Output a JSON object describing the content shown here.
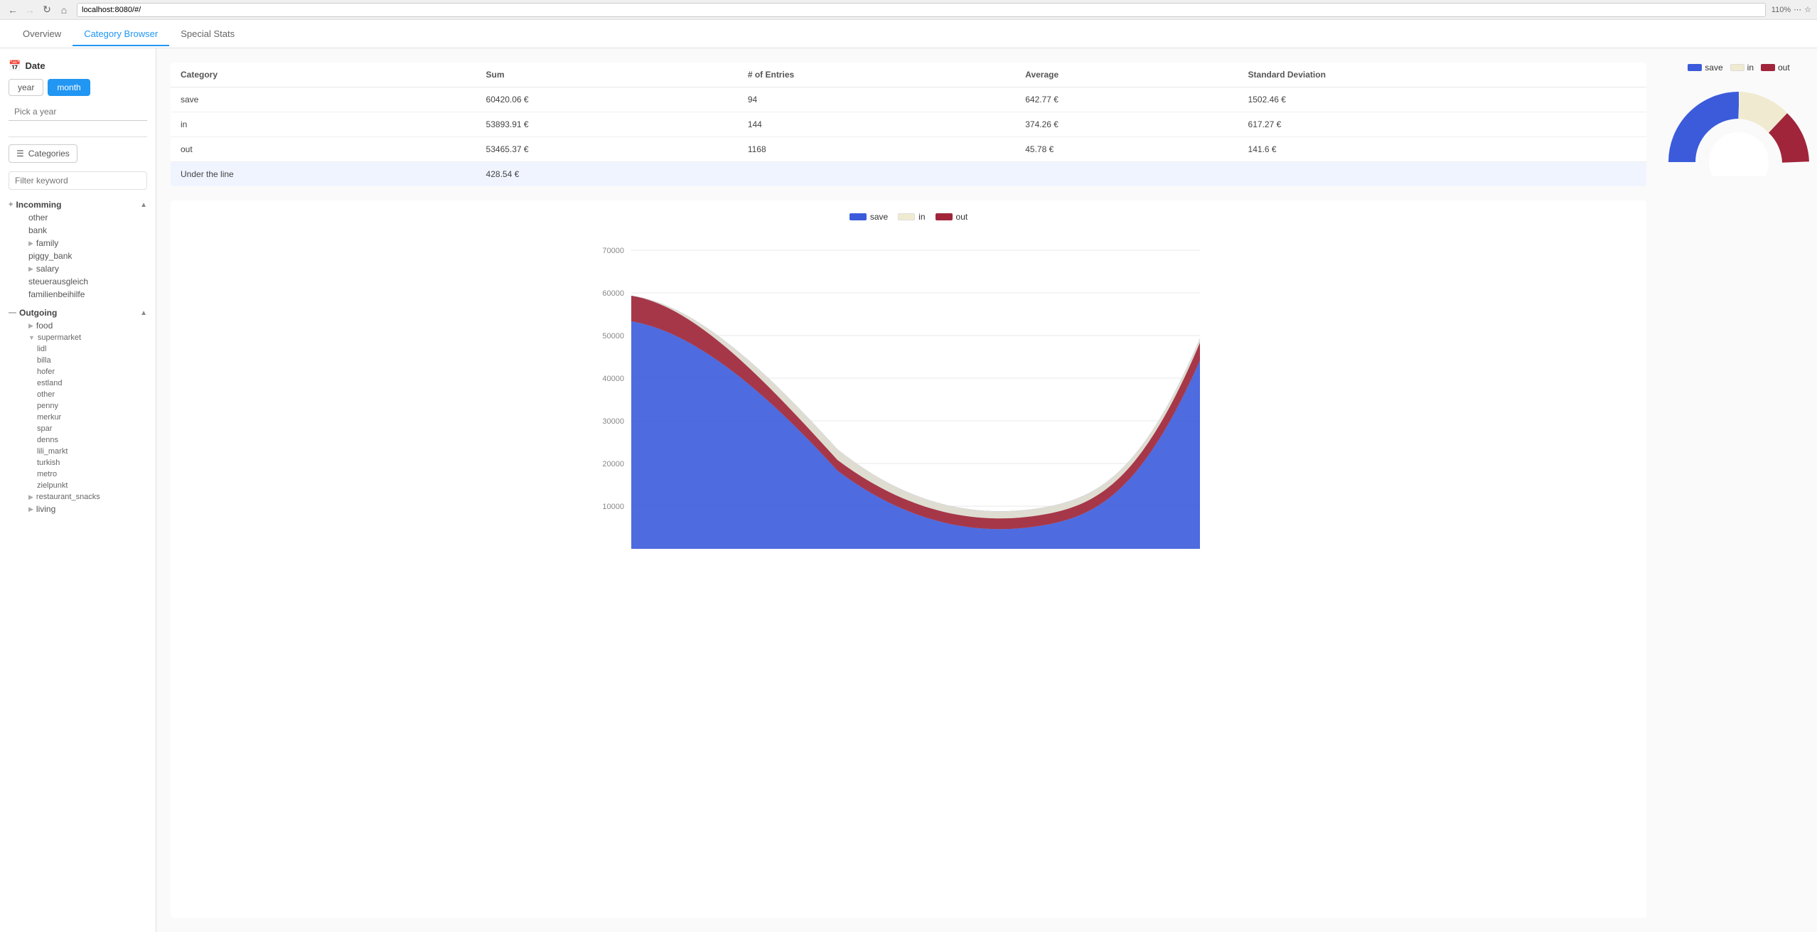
{
  "browser": {
    "url": "localhost:8080/#/",
    "zoom": "110%"
  },
  "tabs": [
    {
      "id": "overview",
      "label": "Overview",
      "active": false
    },
    {
      "id": "category-browser",
      "label": "Category Browser",
      "active": true
    },
    {
      "id": "special-stats",
      "label": "Special Stats",
      "active": false
    }
  ],
  "sidebar": {
    "date_label": "Date",
    "year_btn": "year",
    "month_btn": "month",
    "year_placeholder": "Pick a year",
    "categories_label": "Categories",
    "filter_placeholder": "Filter keyword",
    "incomming_label": "Incomming",
    "incomming_items": [
      {
        "label": "other",
        "level": 1
      },
      {
        "label": "bank",
        "level": 1
      },
      {
        "label": "family",
        "level": 1,
        "has_children": true
      },
      {
        "label": "piggy_bank",
        "level": 1
      },
      {
        "label": "salary",
        "level": 1,
        "has_children": true
      },
      {
        "label": "steuerausgleich",
        "level": 1
      },
      {
        "label": "familienbeihilfe",
        "level": 1
      }
    ],
    "outgoing_label": "Outgoing",
    "outgoing_items": [
      {
        "label": "food",
        "level": 1,
        "has_children": true,
        "children": [
          {
            "label": "supermarket",
            "level": 2,
            "has_children": true,
            "children": [
              {
                "label": "lidl",
                "level": 3
              },
              {
                "label": "billa",
                "level": 3
              },
              {
                "label": "hofer",
                "level": 3
              },
              {
                "label": "estland",
                "level": 3
              },
              {
                "label": "other",
                "level": 3
              },
              {
                "label": "penny",
                "level": 3
              },
              {
                "label": "merkur",
                "level": 3
              },
              {
                "label": "spar",
                "level": 3
              },
              {
                "label": "denns",
                "level": 3
              },
              {
                "label": "lili_markt",
                "level": 3
              },
              {
                "label": "turkish",
                "level": 3
              },
              {
                "label": "metro",
                "level": 3
              },
              {
                "label": "zielpunkt",
                "level": 3
              }
            ]
          },
          {
            "label": "restaurant_snacks",
            "level": 2,
            "has_children": true
          }
        ]
      },
      {
        "label": "living",
        "level": 1,
        "has_children": true
      }
    ]
  },
  "table": {
    "headers": [
      "Category",
      "Sum",
      "# of Entries",
      "Average",
      "Standard Deviation"
    ],
    "rows": [
      {
        "category": "save",
        "sum": "60420.06 €",
        "entries": "94",
        "average": "642.77 €",
        "std_dev": "1502.46 €",
        "highlight": false
      },
      {
        "category": "in",
        "sum": "53893.91 €",
        "entries": "144",
        "average": "374.26 €",
        "std_dev": "617.27 €",
        "highlight": false
      },
      {
        "category": "out",
        "sum": "53465.37 €",
        "entries": "1168",
        "average": "45.78 €",
        "std_dev": "141.6 €",
        "highlight": false
      },
      {
        "category": "Under the line",
        "sum": "428.54 €",
        "entries": "",
        "average": "",
        "std_dev": "",
        "highlight": true
      }
    ]
  },
  "chart": {
    "legend": [
      {
        "label": "save",
        "color": "#3b5bdb"
      },
      {
        "label": "in",
        "color": "#f5f0d0"
      },
      {
        "label": "out",
        "color": "#a0253a"
      }
    ],
    "y_labels": [
      "70000",
      "60000",
      "50000",
      "40000",
      "30000",
      "20000",
      "10000"
    ],
    "colors": {
      "save": "#3b5bdb",
      "in": "#f0ead0",
      "out": "#a0253a"
    }
  },
  "donut": {
    "legend": [
      {
        "label": "save",
        "color": "#3b5bdb"
      },
      {
        "label": "in",
        "color": "#f0ead0"
      },
      {
        "label": "out",
        "color": "#a0253a"
      }
    ]
  }
}
